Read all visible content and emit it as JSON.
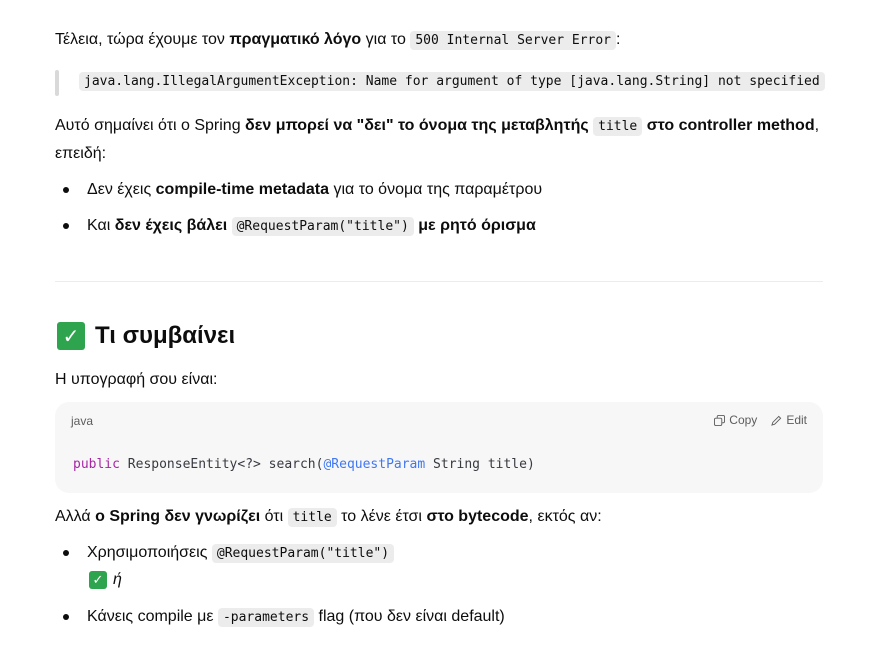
{
  "p1": {
    "t1": "Τέλεια, τώρα έχουμε τον ",
    "b1": "πραγματικό λόγο",
    "t2": " για το ",
    "code1": "500 Internal Server Error",
    "t3": ":"
  },
  "quote": "java.lang.IllegalArgumentException: Name for argument of type [java.lang.String] not specified",
  "p2": {
    "t1": "Αυτό σημαίνει ότι ο Spring ",
    "b1": "δεν μπορεί να \"δει\" το όνομα της μεταβλητής",
    "code1": "title",
    "b2": "στο controller method",
    "t2": ",",
    "line2": "επειδή:"
  },
  "list1": [
    {
      "t1": "Δεν έχεις ",
      "b1": "compile-time metadata",
      "t2": " για το όνομα της παραμέτρου"
    },
    {
      "t1": "Και ",
      "b1": "δεν έχεις βάλει",
      "code1": "@RequestParam(\"title\")",
      "b2": "με ρητό όρισμα"
    }
  ],
  "section": {
    "icon": "check-mark-icon",
    "icon_glyph": "✓",
    "title": "Τι συμβαίνει"
  },
  "p3": "Η υπογραφή σου είναι:",
  "codeblock": {
    "lang": "java",
    "copy_label": "Copy",
    "edit_label": "Edit",
    "copy_icon": "copy-icon",
    "edit_icon": "pencil-icon",
    "kw": "public",
    "t1": " ResponseEntity<?> search(",
    "ann": "@RequestParam",
    "t2": " String title)"
  },
  "p4": {
    "t1": "Αλλά ",
    "b1": "ο Spring δεν γνωρίζει",
    "t2": " ότι ",
    "code1": "title",
    "t3": " το λένε έτσι ",
    "b2": "στο bytecode",
    "t4": ", εκτός αν:"
  },
  "list2": [
    {
      "t1": "Χρησιμοποιήσεις ",
      "code1": "@RequestParam(\"title\")",
      "or": "ή"
    },
    {
      "t1": "Κάνεις compile με ",
      "code1": "-parameters",
      "t2": " flag (που δεν είναι default)"
    }
  ],
  "colors": {
    "text": "#0d0d0d",
    "code_bg": "#ececec",
    "block_bg": "#f7f7f7",
    "check": "#2ea44f",
    "keyword": "#a626a4",
    "annotation": "#4078f2"
  }
}
